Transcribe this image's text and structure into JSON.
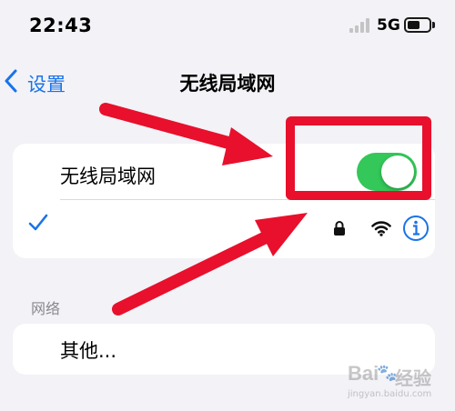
{
  "status_bar": {
    "time": "22:43",
    "network_type": "5G",
    "signal_icon": "cellular-signal-icon",
    "battery_icon": "battery-icon",
    "battery_level": 0.6
  },
  "nav": {
    "back_label": "设置",
    "back_icon": "chevron-left-icon",
    "title": "无线局域网"
  },
  "wifi_section": {
    "toggle_label": "无线局域网",
    "toggle_on": true,
    "connected_network": {
      "name": "",
      "icons": [
        "checkmark-icon",
        "lock-icon",
        "wifi-signal-icon",
        "info-icon"
      ]
    }
  },
  "networks_section": {
    "header": "网络",
    "other_label": "其他..."
  },
  "watermark": {
    "logo_text": "Bai",
    "brand_text": "经验",
    "domain_text": "jingyan.baidu.com"
  },
  "colors": {
    "accent": "#1a73e8",
    "toggle_on": "#34c759",
    "highlight_red": "#e8102c",
    "background": "#f2f2f7"
  }
}
